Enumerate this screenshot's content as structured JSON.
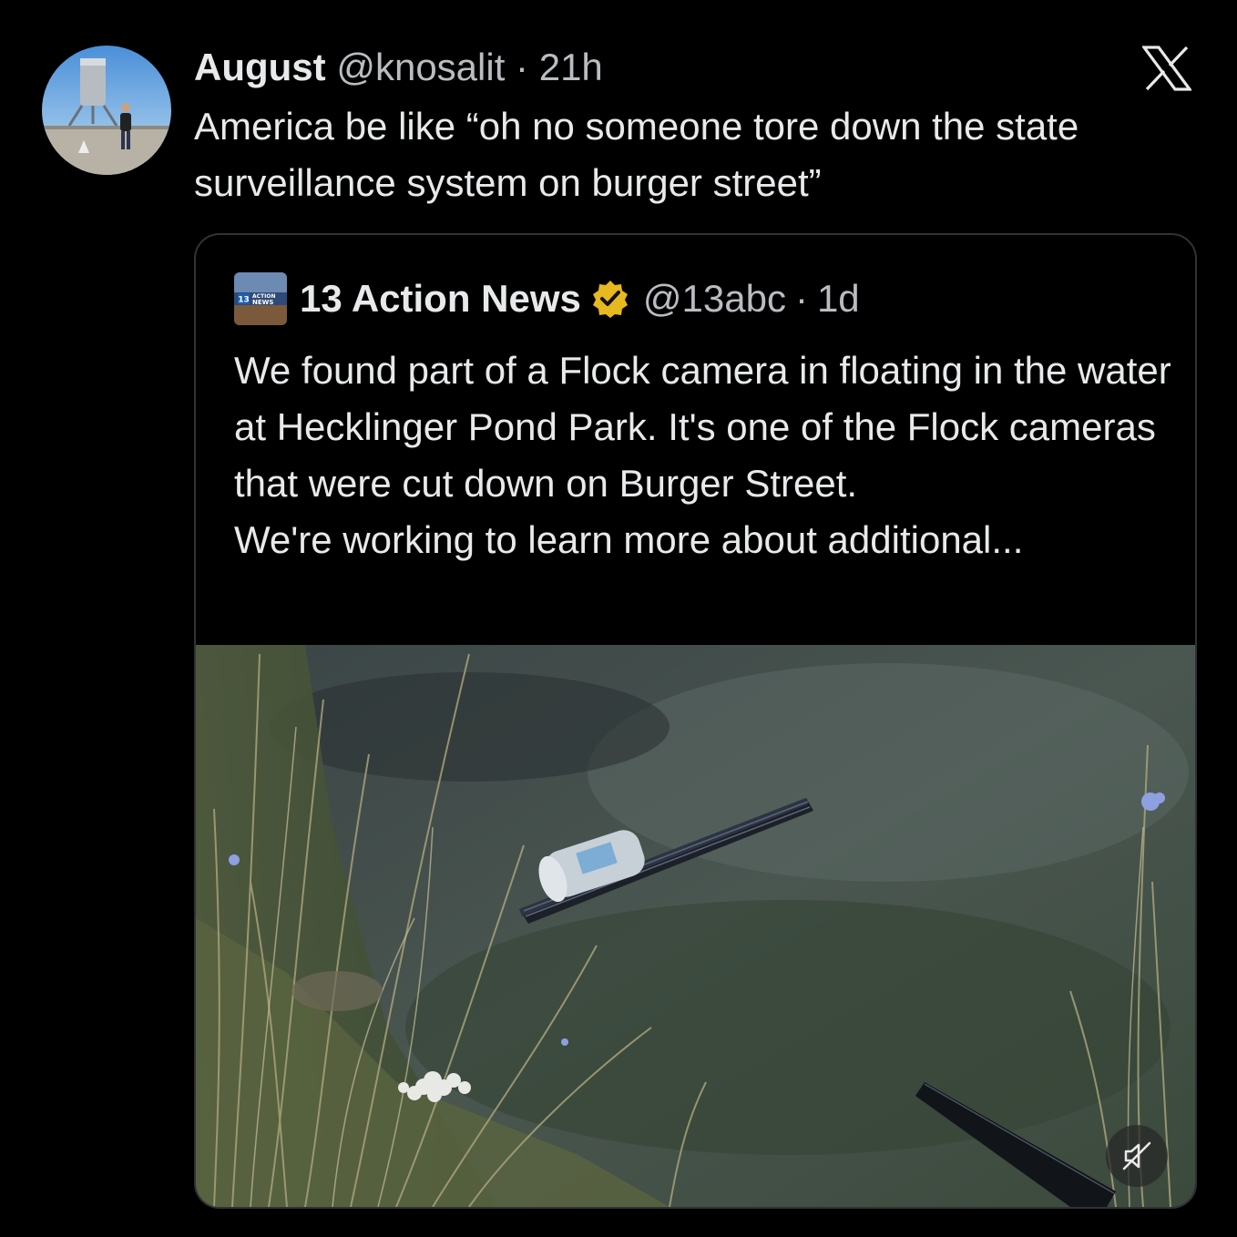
{
  "tweet": {
    "author_name": "August",
    "author_handle": "@knosalit",
    "separator": "·",
    "time": "21h",
    "text": "America be like “oh no someone tore down the state surveillance system on burger street”",
    "avatar_icon": "profile-photo-rocket-test-vehicle",
    "brand_icon": "x-logo-icon"
  },
  "quote": {
    "author_name": "13 Action News",
    "verified_icon": "gold-verified-badge-icon",
    "author_handle": "@13abc",
    "separator": "·",
    "time": "1d",
    "logo_icon": "13-action-news-logo",
    "logo_text": "13 ACTION NEWS",
    "text_lines": [
      "We found part of a Flock camera in floating in the water at Hecklinger Pond Park. It's one of the Flock cameras that were cut down on Burger Street.",
      "We're working to learn more about additional..."
    ],
    "media": {
      "description_icon": "video-thumbnail-pond-debris",
      "mute_icon": "muted-speaker-icon"
    }
  },
  "colors": {
    "background": "#000000",
    "text_primary": "#e7e9ea",
    "text_secondary": "#b9bdc1",
    "border": "#2f3336",
    "verified_gold": "#e8b820"
  }
}
